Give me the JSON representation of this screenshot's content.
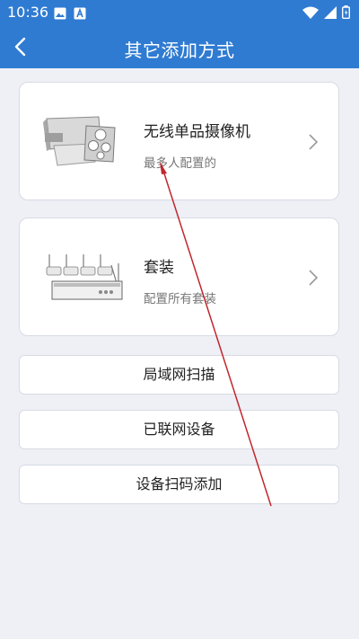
{
  "status_bar": {
    "time": "10:36",
    "left_icons": [
      "image-icon",
      "app-a-icon"
    ],
    "right_icons": [
      "wifi-icon",
      "signal-icon",
      "battery-icon"
    ]
  },
  "header": {
    "title": "其它添加方式",
    "back_icon": "back-arrow-icon",
    "background_color": "#2f7bd2"
  },
  "options": [
    {
      "title": "无线单品摄像机",
      "subtitle": "最多人配置的",
      "icon": "bullet-camera-image"
    },
    {
      "title": "套装",
      "subtitle": "配置所有套装",
      "icon": "nvr-camera-kit-image"
    }
  ],
  "buttons": [
    {
      "label": "局域网扫描"
    },
    {
      "label": "已联网设备"
    },
    {
      "label": "设备扫码添加"
    }
  ],
  "annotation": {
    "type": "red-arrow",
    "color": "#c0272d"
  }
}
